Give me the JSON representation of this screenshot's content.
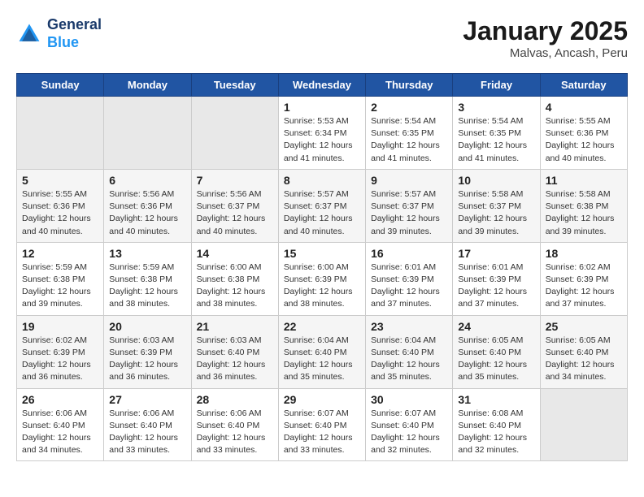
{
  "header": {
    "logo_line1": "General",
    "logo_line2": "Blue",
    "title": "January 2025",
    "subtitle": "Malvas, Ancash, Peru"
  },
  "days_of_week": [
    "Sunday",
    "Monday",
    "Tuesday",
    "Wednesday",
    "Thursday",
    "Friday",
    "Saturday"
  ],
  "weeks": [
    [
      {
        "num": "",
        "info": ""
      },
      {
        "num": "",
        "info": ""
      },
      {
        "num": "",
        "info": ""
      },
      {
        "num": "1",
        "info": "Sunrise: 5:53 AM\nSunset: 6:34 PM\nDaylight: 12 hours\nand 41 minutes."
      },
      {
        "num": "2",
        "info": "Sunrise: 5:54 AM\nSunset: 6:35 PM\nDaylight: 12 hours\nand 41 minutes."
      },
      {
        "num": "3",
        "info": "Sunrise: 5:54 AM\nSunset: 6:35 PM\nDaylight: 12 hours\nand 41 minutes."
      },
      {
        "num": "4",
        "info": "Sunrise: 5:55 AM\nSunset: 6:36 PM\nDaylight: 12 hours\nand 40 minutes."
      }
    ],
    [
      {
        "num": "5",
        "info": "Sunrise: 5:55 AM\nSunset: 6:36 PM\nDaylight: 12 hours\nand 40 minutes."
      },
      {
        "num": "6",
        "info": "Sunrise: 5:56 AM\nSunset: 6:36 PM\nDaylight: 12 hours\nand 40 minutes."
      },
      {
        "num": "7",
        "info": "Sunrise: 5:56 AM\nSunset: 6:37 PM\nDaylight: 12 hours\nand 40 minutes."
      },
      {
        "num": "8",
        "info": "Sunrise: 5:57 AM\nSunset: 6:37 PM\nDaylight: 12 hours\nand 40 minutes."
      },
      {
        "num": "9",
        "info": "Sunrise: 5:57 AM\nSunset: 6:37 PM\nDaylight: 12 hours\nand 39 minutes."
      },
      {
        "num": "10",
        "info": "Sunrise: 5:58 AM\nSunset: 6:37 PM\nDaylight: 12 hours\nand 39 minutes."
      },
      {
        "num": "11",
        "info": "Sunrise: 5:58 AM\nSunset: 6:38 PM\nDaylight: 12 hours\nand 39 minutes."
      }
    ],
    [
      {
        "num": "12",
        "info": "Sunrise: 5:59 AM\nSunset: 6:38 PM\nDaylight: 12 hours\nand 39 minutes."
      },
      {
        "num": "13",
        "info": "Sunrise: 5:59 AM\nSunset: 6:38 PM\nDaylight: 12 hours\nand 38 minutes."
      },
      {
        "num": "14",
        "info": "Sunrise: 6:00 AM\nSunset: 6:38 PM\nDaylight: 12 hours\nand 38 minutes."
      },
      {
        "num": "15",
        "info": "Sunrise: 6:00 AM\nSunset: 6:39 PM\nDaylight: 12 hours\nand 38 minutes."
      },
      {
        "num": "16",
        "info": "Sunrise: 6:01 AM\nSunset: 6:39 PM\nDaylight: 12 hours\nand 37 minutes."
      },
      {
        "num": "17",
        "info": "Sunrise: 6:01 AM\nSunset: 6:39 PM\nDaylight: 12 hours\nand 37 minutes."
      },
      {
        "num": "18",
        "info": "Sunrise: 6:02 AM\nSunset: 6:39 PM\nDaylight: 12 hours\nand 37 minutes."
      }
    ],
    [
      {
        "num": "19",
        "info": "Sunrise: 6:02 AM\nSunset: 6:39 PM\nDaylight: 12 hours\nand 36 minutes."
      },
      {
        "num": "20",
        "info": "Sunrise: 6:03 AM\nSunset: 6:39 PM\nDaylight: 12 hours\nand 36 minutes."
      },
      {
        "num": "21",
        "info": "Sunrise: 6:03 AM\nSunset: 6:40 PM\nDaylight: 12 hours\nand 36 minutes."
      },
      {
        "num": "22",
        "info": "Sunrise: 6:04 AM\nSunset: 6:40 PM\nDaylight: 12 hours\nand 35 minutes."
      },
      {
        "num": "23",
        "info": "Sunrise: 6:04 AM\nSunset: 6:40 PM\nDaylight: 12 hours\nand 35 minutes."
      },
      {
        "num": "24",
        "info": "Sunrise: 6:05 AM\nSunset: 6:40 PM\nDaylight: 12 hours\nand 35 minutes."
      },
      {
        "num": "25",
        "info": "Sunrise: 6:05 AM\nSunset: 6:40 PM\nDaylight: 12 hours\nand 34 minutes."
      }
    ],
    [
      {
        "num": "26",
        "info": "Sunrise: 6:06 AM\nSunset: 6:40 PM\nDaylight: 12 hours\nand 34 minutes."
      },
      {
        "num": "27",
        "info": "Sunrise: 6:06 AM\nSunset: 6:40 PM\nDaylight: 12 hours\nand 33 minutes."
      },
      {
        "num": "28",
        "info": "Sunrise: 6:06 AM\nSunset: 6:40 PM\nDaylight: 12 hours\nand 33 minutes."
      },
      {
        "num": "29",
        "info": "Sunrise: 6:07 AM\nSunset: 6:40 PM\nDaylight: 12 hours\nand 33 minutes."
      },
      {
        "num": "30",
        "info": "Sunrise: 6:07 AM\nSunset: 6:40 PM\nDaylight: 12 hours\nand 32 minutes."
      },
      {
        "num": "31",
        "info": "Sunrise: 6:08 AM\nSunset: 6:40 PM\nDaylight: 12 hours\nand 32 minutes."
      },
      {
        "num": "",
        "info": ""
      }
    ]
  ]
}
